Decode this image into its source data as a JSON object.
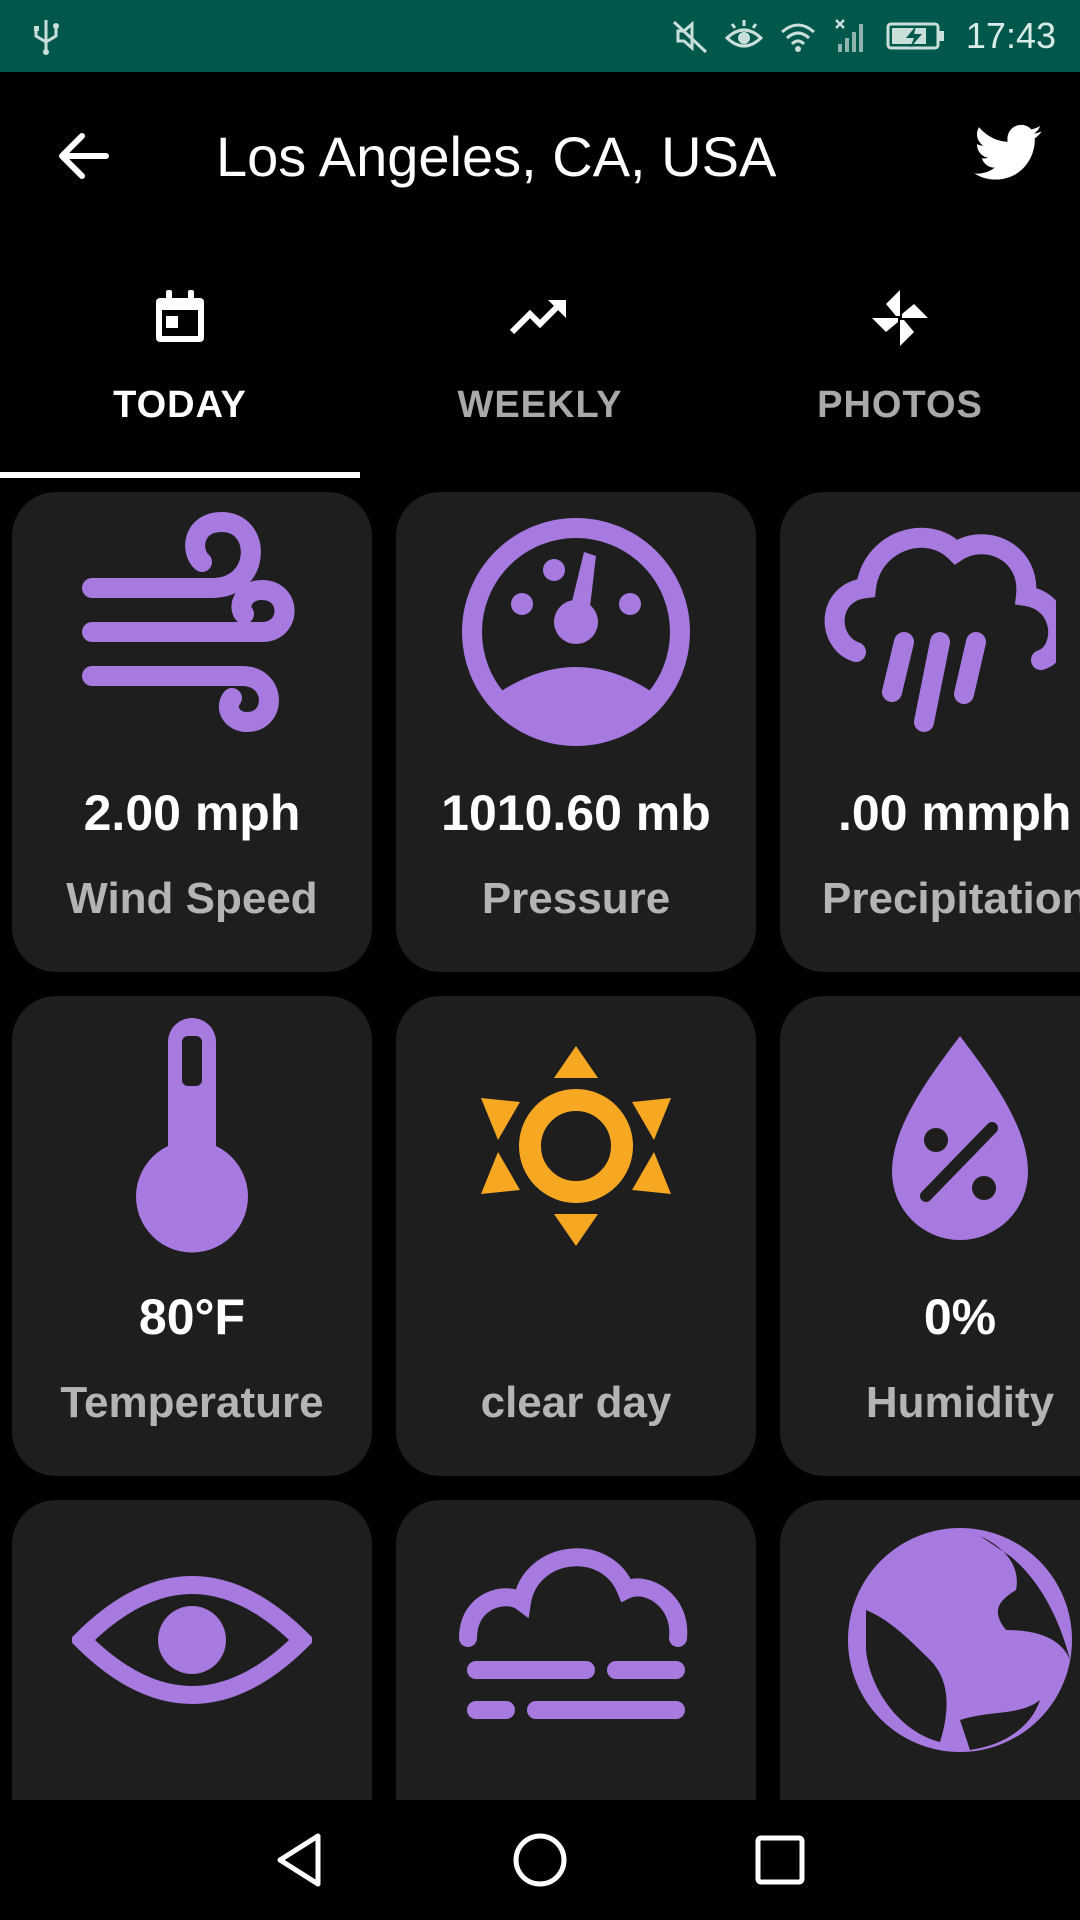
{
  "status_bar": {
    "time": "17:43",
    "icons": [
      "usb-icon",
      "mute-icon",
      "eye-comfort-icon",
      "wifi-icon",
      "signal-icon",
      "battery-charging-icon"
    ]
  },
  "app_bar": {
    "title": "Los Angeles, CA, USA",
    "back_icon": "arrow-left-icon",
    "share_icon": "twitter-icon"
  },
  "tabs": [
    {
      "label": "TODAY",
      "icon": "calendar-today-icon",
      "active": true
    },
    {
      "label": "WEEKLY",
      "icon": "trending-up-icon",
      "active": false
    },
    {
      "label": "PHOTOS",
      "icon": "pinwheel-icon",
      "active": false
    }
  ],
  "cards": [
    {
      "icon": "wind-icon",
      "value": "2.00 mph",
      "label": "Wind Speed"
    },
    {
      "icon": "gauge-icon",
      "value": "1010.60 mb",
      "label": "Pressure"
    },
    {
      "icon": "rain-cloud-icon",
      "value": ".00 mmph",
      "label": "Precipitation"
    },
    {
      "icon": "thermometer-icon",
      "value": "80°F",
      "label": "Temperature"
    },
    {
      "icon": "sun-icon",
      "value": "",
      "label": "clear day"
    },
    {
      "icon": "humidity-drop-icon",
      "value": "0%",
      "label": "Humidity"
    },
    {
      "icon": "eye-icon",
      "value": "",
      "label": ""
    },
    {
      "icon": "fog-cloud-icon",
      "value": "",
      "label": ""
    },
    {
      "icon": "globe-icon",
      "value": "",
      "label": ""
    }
  ],
  "nav_bar": {
    "icons": [
      "back-triangle-icon",
      "home-circle-icon",
      "recents-square-icon"
    ]
  },
  "colors": {
    "status_bar": "#00574b",
    "background": "#000000",
    "card": "#1e1e1e",
    "accent_purple": "#a77ae0",
    "sun_orange": "#f7a823"
  }
}
